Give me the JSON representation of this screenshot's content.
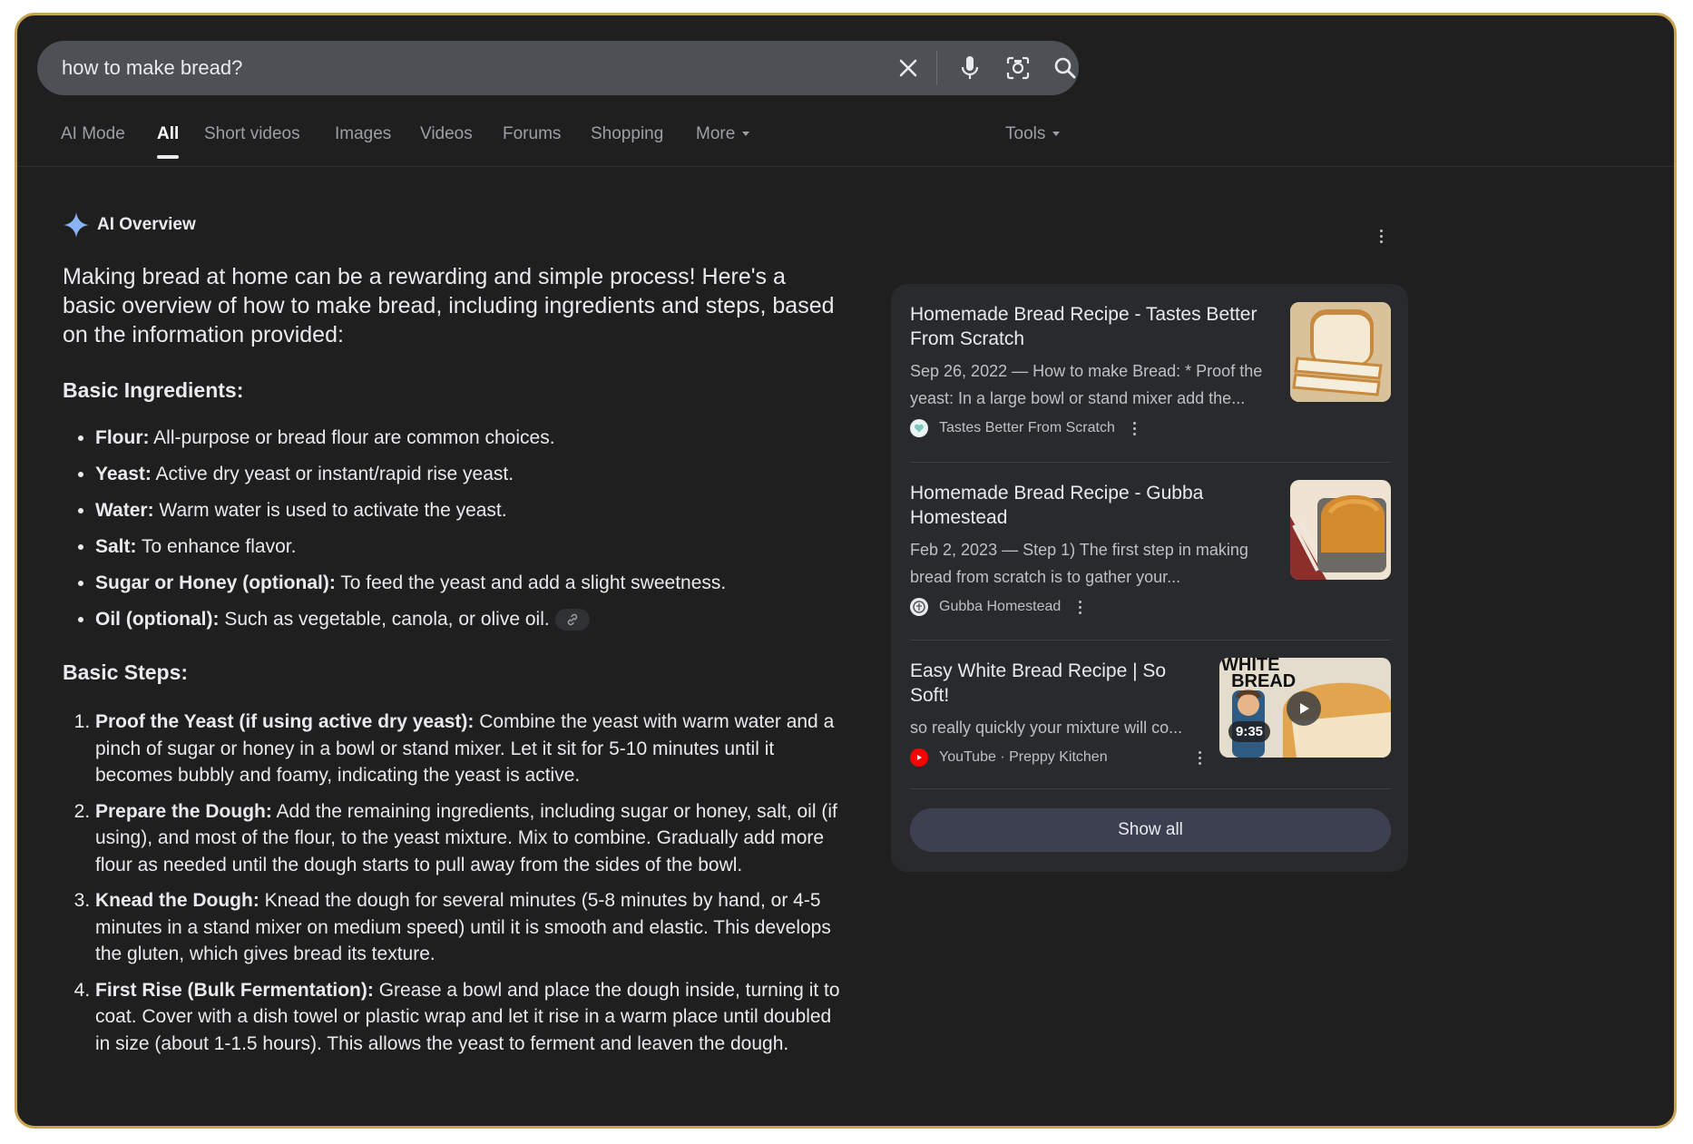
{
  "search": {
    "query": "how to make bread?"
  },
  "tabs": [
    {
      "label": "AI Mode"
    },
    {
      "label": "All"
    },
    {
      "label": "Short videos"
    },
    {
      "label": "Images"
    },
    {
      "label": "Videos"
    },
    {
      "label": "Forums"
    },
    {
      "label": "Shopping"
    },
    {
      "label": "More"
    },
    {
      "label": "Tools"
    }
  ],
  "ai_overview": {
    "label": "AI Overview",
    "intro": "Making bread at home can be a rewarding and simple process! Here's a basic overview of how to make bread, including ingredients and steps, based on the information provided:",
    "ingredients_heading": "Basic Ingredients:",
    "ingredients": [
      {
        "term": "Flour:",
        "text": " All-purpose or bread flour are common choices."
      },
      {
        "term": "Yeast:",
        "text": " Active dry yeast or instant/rapid rise yeast."
      },
      {
        "term": "Water:",
        "text": " Warm water is used to activate the yeast."
      },
      {
        "term": "Salt:",
        "text": " To enhance flavor."
      },
      {
        "term": "Sugar or Honey (optional):",
        "text": " To feed the yeast and add a slight sweetness."
      },
      {
        "term": "Oil (optional):",
        "text": " Such as vegetable, canola, or olive oil."
      }
    ],
    "steps_heading": "Basic Steps:",
    "steps": [
      {
        "term": "Proof the Yeast (if using active dry yeast):",
        "text": " Combine the yeast with warm water and a pinch of sugar or honey in a bowl or stand mixer. Let it sit for 5-10 minutes until it becomes bubbly and foamy, indicating the yeast is active."
      },
      {
        "term": "Prepare the Dough:",
        "text": " Add the remaining ingredients, including sugar or honey, salt, oil (if using), and most of the flour, to the yeast mixture. Mix to combine. Gradually add more flour as needed until the dough starts to pull away from the sides of the bowl."
      },
      {
        "term": "Knead the Dough:",
        "text": " Knead the dough for several minutes (5-8 minutes by hand, or 4-5 minutes in a stand mixer on medium speed) until it is smooth and elastic. This develops the gluten, which gives bread its texture."
      },
      {
        "term": "First Rise (Bulk Fermentation):",
        "text": " Grease a bowl and place the dough inside, turning it to coat. Cover with a dish towel or plastic wrap and let it rise in a warm place until doubled in size (about 1-1.5 hours). This allows the yeast to ferment and leaven the dough."
      }
    ]
  },
  "sources": [
    {
      "title": "Homemade Bread Recipe - Tastes Better From Scratch",
      "snippet": "Sep 26, 2022 — How to make Bread: * Proof the yeast: In a large bowl or stand mixer add the...",
      "site": "Tastes Better From Scratch"
    },
    {
      "title": "Homemade Bread Recipe - Gubba Homestead",
      "snippet": "Feb 2, 2023 — Step 1) The first step in making bread from scratch is to gather your...",
      "site": "Gubba Homestead"
    },
    {
      "title": "Easy White Bread Recipe | So Soft!",
      "snippet": "so really quickly your mixture will co...",
      "site": "YouTube · Preppy Kitchen",
      "thumb_text": "WHITE BREAD",
      "duration": "9:35"
    }
  ],
  "show_all_label": "Show all",
  "colors": {
    "background": "#1f1f1f",
    "searchbar": "#4d5156",
    "panel": "#282a2d",
    "accent_spark": "#8ab4f8",
    "youtube_red": "#ff0000"
  }
}
